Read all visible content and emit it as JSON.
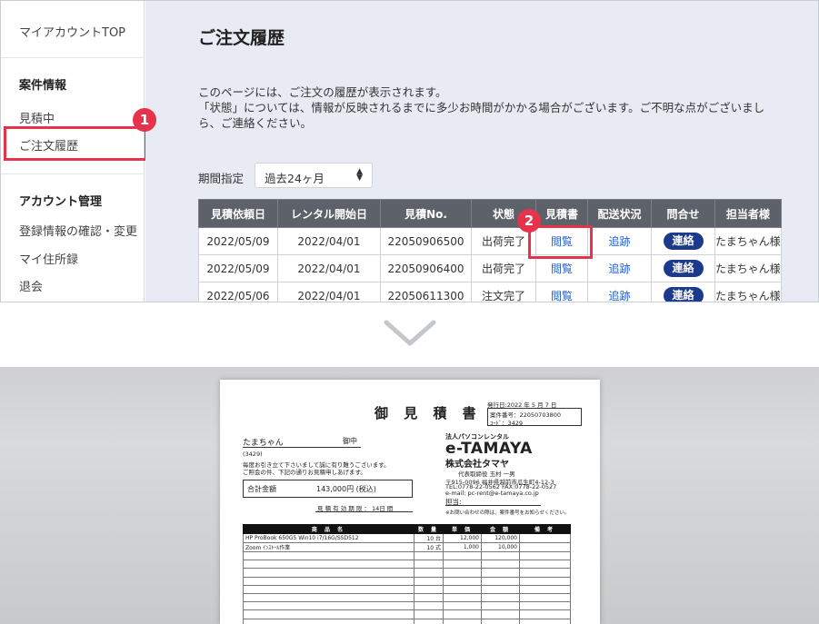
{
  "sidebar": {
    "top_link": "マイアカウントTOP",
    "section1_title": "案件情報",
    "items1": [
      "見積中",
      "ご注文履歴"
    ],
    "section2_title": "アカウント管理",
    "items2": [
      "登録情報の確認・変更",
      "マイ住所録",
      "退会"
    ]
  },
  "badges": [
    "1",
    "2"
  ],
  "main": {
    "title": "ご注文履歴",
    "desc_line1": "このページには、ご注文の履歴が表示されます。",
    "desc_line2": "「状態」については、情報が反映されるまでに多少お時間がかかる場合がございます。ご不明な点がございまし",
    "desc_line3": "ら、ご連絡ください。",
    "period_label": "期間指定",
    "period_value": "過去24ヶ月"
  },
  "table": {
    "headers": [
      "見積依頼日",
      "レンタル開始日",
      "見積No.",
      "状態",
      "見積書",
      "配送状況",
      "問合せ",
      "担当者様"
    ],
    "rows": [
      [
        "2022/05/09",
        "2022/04/01",
        "22050906500",
        "出荷完了",
        "閲覧",
        "追跡",
        "連絡",
        "たまちゃん様"
      ],
      [
        "2022/05/09",
        "2022/04/01",
        "22050906400",
        "出荷完了",
        "閲覧",
        "追跡",
        "連絡",
        "たまちゃん様"
      ],
      [
        "2022/05/06",
        "2022/04/01",
        "22050611300",
        "注文完了",
        "閲覧",
        "追跡",
        "連絡",
        "たまちゃん様"
      ]
    ]
  },
  "document": {
    "title": "御 見 積 書",
    "issue_date": "発行日:2022 年  5 月  7 日",
    "case_no": "案件番号：22050703800",
    "code": "ｺｰﾄﾞ：3429",
    "customer": "たまちゃん",
    "honorific": "御中",
    "customer_code": "(3429)",
    "greeting1": "毎度お引き立て下さいまして誠に有り難うございます。",
    "greeting2": "ご照会の件、下記の通りお見積申しあげます。",
    "total_label": "合計金額",
    "total_value": "143,000円 (税込)",
    "validity": "見 積 有 効 期 限 ：  14日 間",
    "company_tag": "法人パソコンレンタル",
    "brand": "e-TAMAYA",
    "company": "株式会社タマヤ",
    "rep": "代表取締役  玉村  一男",
    "addr1": "〒915-0096 福井県越前市瓜生町4-12-3",
    "addr2": "TEL:0778-22-0562  FAX:0778-22-0527",
    "email": "e-mail: pc-rent@e-tamaya.co.jp",
    "person_label": "担当:",
    "notice": "※お問い合わせの際は、案件番号をお知らせください。",
    "item_headers": [
      "商 品 名",
      "数 量",
      "単 価",
      "金 額",
      "備 考"
    ],
    "items": [
      [
        "HP ProBook 650G5 Win10 i7/16G/SSD512",
        "10 台",
        "12,000",
        "120,000",
        ""
      ],
      [
        "Zoom ｲﾝｽﾄｰﾙ作業",
        "10 式",
        "1,000",
        "10,000",
        ""
      ]
    ],
    "empty_rows": 9
  }
}
